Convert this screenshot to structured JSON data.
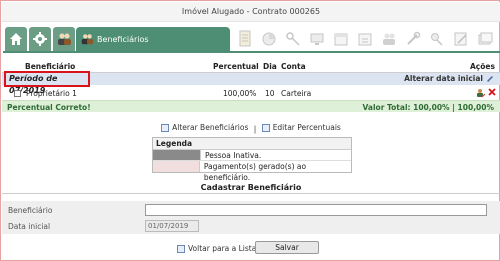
{
  "window": {
    "title": "Imóvel Alugado - Contrato 000265"
  },
  "toolbar": {
    "active_tab_label": "Beneficiários",
    "icons_left": [
      "home-icon",
      "gear-icon",
      "people-icon"
    ],
    "icons_right": [
      "document-icon",
      "chart-icon",
      "key-icon",
      "computer-icon",
      "calendar-icon",
      "calendar-alt-icon",
      "people-group-icon",
      "tools-icon",
      "key-alt-icon",
      "edit-icon",
      "stack-icon"
    ],
    "accent": "#4d8e74"
  },
  "table": {
    "headers": {
      "beneficiario": "Beneficiário",
      "percentual": "Percentual",
      "dia": "Dia",
      "conta": "Conta",
      "acoes": "Ações"
    },
    "period": {
      "label": "Período de 07/2019",
      "alter_date_label": "Alterar data inicial"
    },
    "rows": [
      {
        "name": "Proprietário 1",
        "percentual": "100,00%",
        "dia": "10",
        "conta": "Carteira"
      }
    ],
    "status": {
      "message": "Percentual Correto!",
      "total": "Valor Total: 100,00% | 100,00%"
    }
  },
  "links": {
    "alter_beneficiarios": "Alterar Beneficiários",
    "edit_percentuais": "Editar Percentuais"
  },
  "legend": {
    "title": "Legenda",
    "items": [
      {
        "color": "#8a8a8a",
        "label": "Pessoa Inativa."
      },
      {
        "color": "#f1dede",
        "label": "Pagamento(s) gerado(s) ao beneficiário."
      }
    ]
  },
  "form": {
    "title": "Cadastrar Beneficiário",
    "beneficiario_label": "Beneficiário",
    "beneficiario_value": "",
    "data_inicial_label": "Data inicial",
    "data_inicial_value": "01/07/2019"
  },
  "footer": {
    "back_label": "Voltar para a Lista",
    "save_label": "Salvar"
  }
}
